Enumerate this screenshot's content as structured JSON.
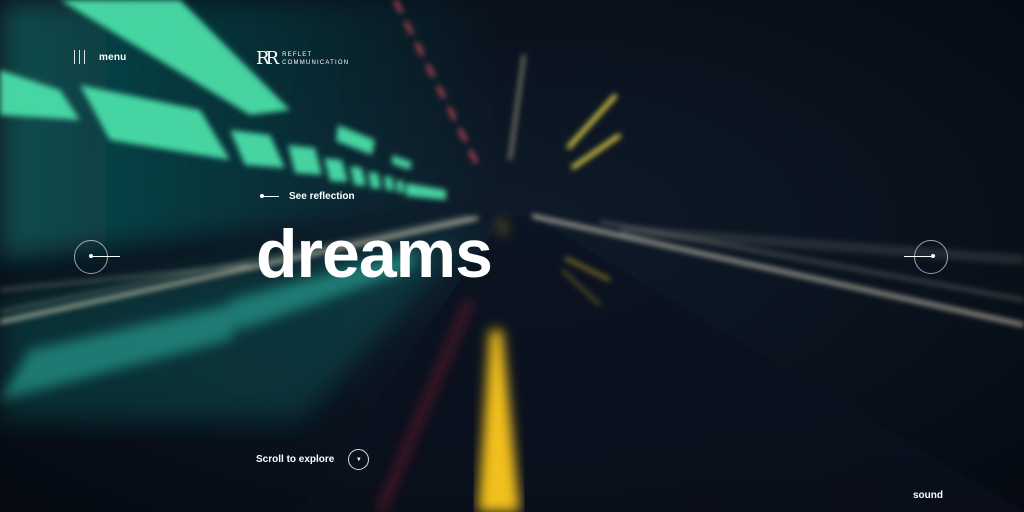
{
  "header": {
    "menu_label": "menu",
    "logo_mark": "RR",
    "logo_line1": "REFLET",
    "logo_line2": "COMMUNICATION"
  },
  "hero": {
    "see_reflection": "See reflection",
    "headline": "dreams"
  },
  "navigation": {
    "prev_icon": "arrow-left-icon",
    "next_icon": "arrow-right-icon"
  },
  "footer": {
    "scroll_label": "Scroll to explore",
    "sound_label": "sound"
  },
  "colors": {
    "background": "#0b1420",
    "teal_light": "#49e3a6",
    "yellow_line": "#f4c62a",
    "red_light": "#d14a5a",
    "text": "#ffffff"
  }
}
